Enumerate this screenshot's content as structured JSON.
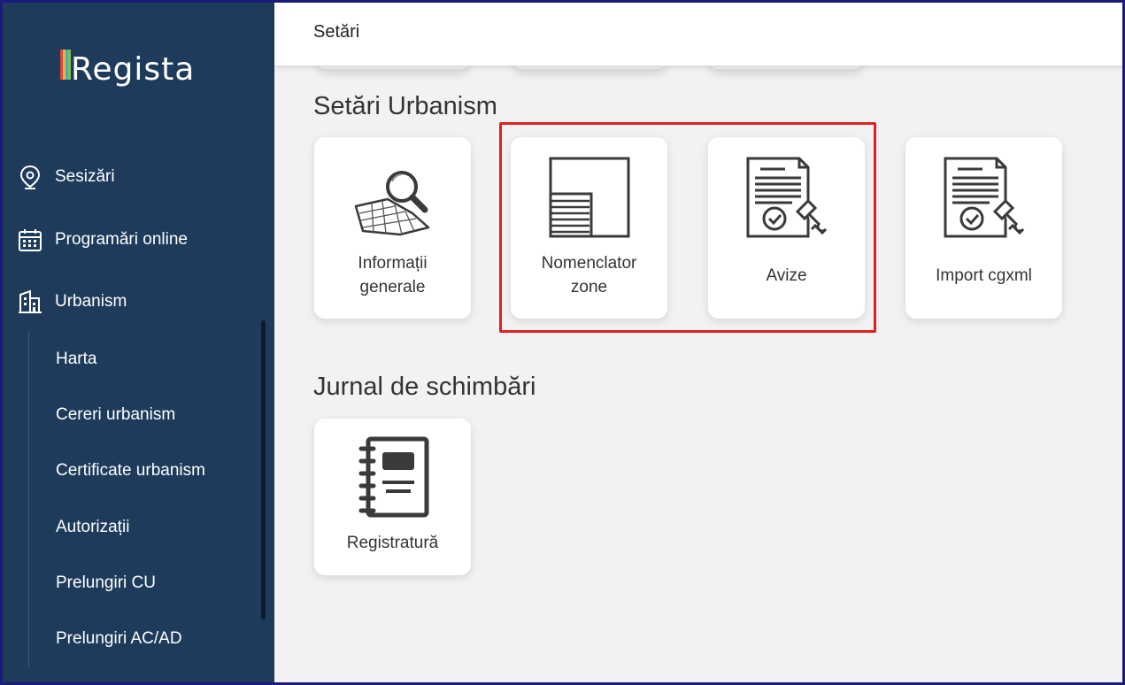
{
  "app": {
    "logo_text": "Regista"
  },
  "sidebar": {
    "items": [
      {
        "label": "Sesizări",
        "icon": "location-pin-icon"
      },
      {
        "label": "Programări online",
        "icon": "calendar-icon"
      },
      {
        "label": "Urbanism",
        "icon": "building-icon"
      }
    ],
    "sub_items": [
      {
        "label": "Harta"
      },
      {
        "label": "Cereri urbanism"
      },
      {
        "label": "Certificate urbanism"
      },
      {
        "label": "Autorizații"
      },
      {
        "label": "Prelungiri CU"
      },
      {
        "label": "Prelungiri AC/AD"
      }
    ]
  },
  "header": {
    "title": "Setări"
  },
  "sections": [
    {
      "title": "Setări Urbanism",
      "cards": [
        {
          "label": "Informații generale",
          "icon": "map-search-icon"
        },
        {
          "label": "Nomenclator zone",
          "icon": "zone-layout-icon"
        },
        {
          "label": "Avize",
          "icon": "certified-document-icon"
        },
        {
          "label": "Import cgxml",
          "icon": "certified-document-icon"
        }
      ]
    },
    {
      "title": "Jurnal de schimbări",
      "cards": [
        {
          "label": "Registratură",
          "icon": "notebook-icon"
        }
      ]
    }
  ],
  "colors": {
    "sidebar": "#1e3b5c",
    "highlight": "#e02020",
    "background": "#f2f2f2"
  }
}
